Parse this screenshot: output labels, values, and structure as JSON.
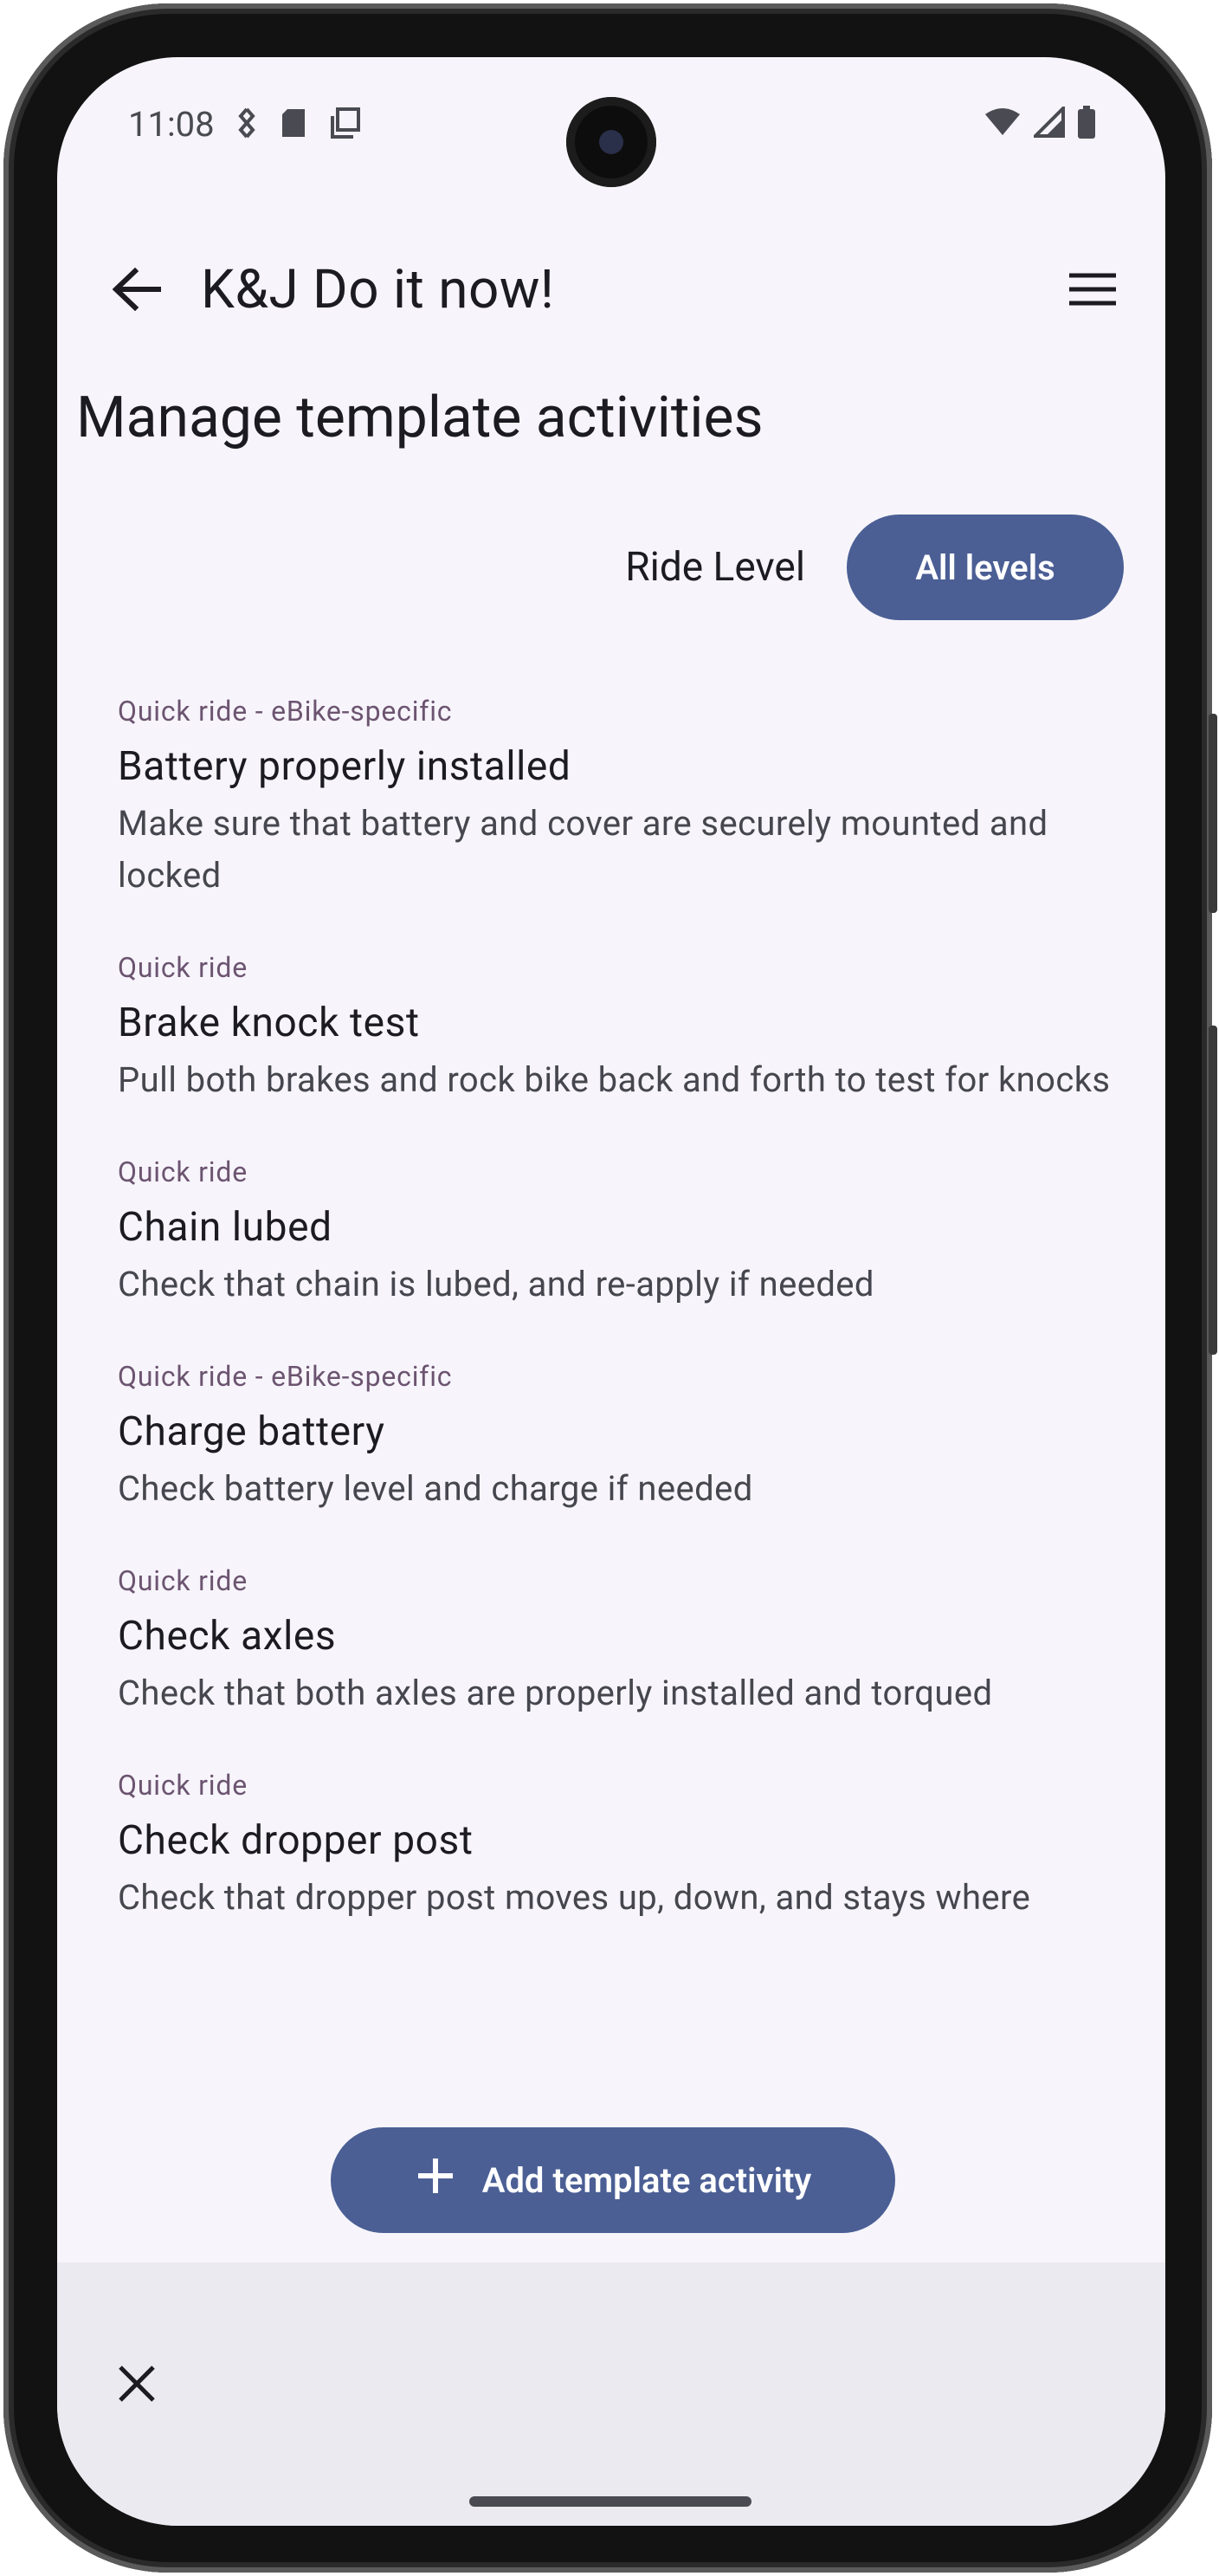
{
  "status_bar": {
    "time": "11:08",
    "left_icons": [
      "vibrate-icon",
      "sd-card-icon",
      "copy-icon"
    ],
    "right_icons": [
      "wifi-icon",
      "signal-icon",
      "battery-icon"
    ]
  },
  "app_bar": {
    "title": "K&J Do it now!",
    "back_icon": "arrow-back-icon",
    "menu_icon": "menu-icon"
  },
  "page": {
    "title": "Manage template activities"
  },
  "filters": {
    "ride_level_label": "Ride Level",
    "selected_chip": "All levels"
  },
  "activities": [
    {
      "category": "Quick ride - eBike-specific",
      "title": "Battery properly installed",
      "description": "Make sure that battery and cover are securely mounted and locked"
    },
    {
      "category": "Quick ride",
      "title": "Brake knock test",
      "description": "Pull both brakes and rock bike back and forth to test for knocks"
    },
    {
      "category": "Quick ride",
      "title": "Chain lubed",
      "description": "Check that chain is lubed, and re-apply if needed"
    },
    {
      "category": "Quick ride - eBike-specific",
      "title": "Charge battery",
      "description": "Check battery level and charge if needed"
    },
    {
      "category": "Quick ride",
      "title": "Check axles",
      "description": "Check that both axles are properly installed and torqued"
    },
    {
      "category": "Quick ride",
      "title": "Check dropper post",
      "description": "Check that dropper post moves up, down, and stays where"
    }
  ],
  "fab": {
    "label": "Add template activity",
    "icon": "plus-icon"
  },
  "bottom_bar": {
    "close_icon": "close-icon"
  },
  "colors": {
    "primary": "#4b5f95",
    "background": "#f7f5fb",
    "category_text": "#6c5470",
    "bottom_bar": "#eceaf1"
  }
}
